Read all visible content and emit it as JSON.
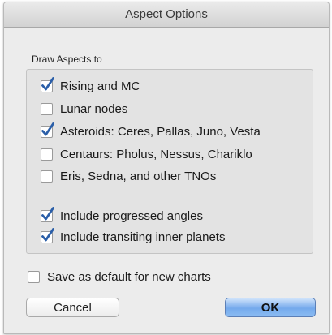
{
  "window": {
    "title": "Aspect Options"
  },
  "group": {
    "label": "Draw Aspects to",
    "items": [
      {
        "label": "Rising and MC",
        "checked": true
      },
      {
        "label": "Lunar nodes",
        "checked": false
      },
      {
        "label": "Asteroids: Ceres, Pallas, Juno, Vesta",
        "checked": true
      },
      {
        "label": "Centaurs: Pholus, Nessus, Chariklo",
        "checked": false
      },
      {
        "label": "Eris, Sedna, and other TNOs",
        "checked": false
      },
      {
        "label": "Include progressed angles",
        "checked": true
      },
      {
        "label": "Include transiting inner planets",
        "checked": true
      }
    ]
  },
  "save_default": {
    "label": "Save as default for new charts",
    "checked": false
  },
  "buttons": {
    "cancel": "Cancel",
    "ok": "OK"
  },
  "colors": {
    "checkmark": "#2a5ea8",
    "ok_button": "#74a9ec"
  }
}
